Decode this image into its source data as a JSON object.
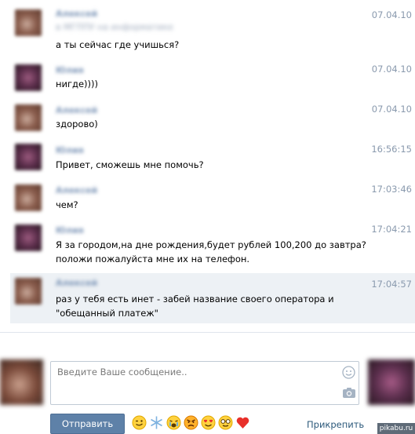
{
  "messages": [
    {
      "author": "Алексей",
      "status": "в МГППУ на информатике",
      "time": "07.04.10",
      "lines": [
        "а ты сейчас где учишься?"
      ]
    },
    {
      "author": "Юлия",
      "time": "07.04.10",
      "lines": [
        "нигде))))"
      ]
    },
    {
      "author": "Алексей",
      "time": "07.04.10",
      "lines": [
        "здорово)"
      ]
    },
    {
      "author": "Юлия",
      "time": "16:56:15",
      "lines": [
        "Привет, сможешь мне помочь?"
      ]
    },
    {
      "author": "Алексей",
      "time": "17:03:46",
      "lines": [
        "чем?"
      ]
    },
    {
      "author": "Юлия",
      "time": "17:04:21",
      "lines": [
        "Я за городом,на дне рождения,будет рублей 100,200 до завтра?",
        "положи пожалуйста мне их на телефон."
      ]
    },
    {
      "author": "Алексей",
      "time": "17:04:57",
      "lines": [
        "раз у тебя есть инет - забей название своего оператора и",
        "\"обещанный платеж\""
      ]
    }
  ],
  "composer": {
    "placeholder": "Введите Ваше сообщение..",
    "value": "",
    "send_label": "Отправить",
    "attach_label": "Прикрепить",
    "emojis": [
      "wink-emoji",
      "snowflake-emoji",
      "crying-emoji",
      "angry-emoji",
      "heart-eyes-emoji",
      "glasses-emoji",
      "heart-emoji"
    ]
  },
  "watermark": "pikabu.ru",
  "colors": {
    "accent": "#5e81a8",
    "link": "#2b587a",
    "time": "#8a9aae",
    "highlight": "#edf1f5"
  }
}
